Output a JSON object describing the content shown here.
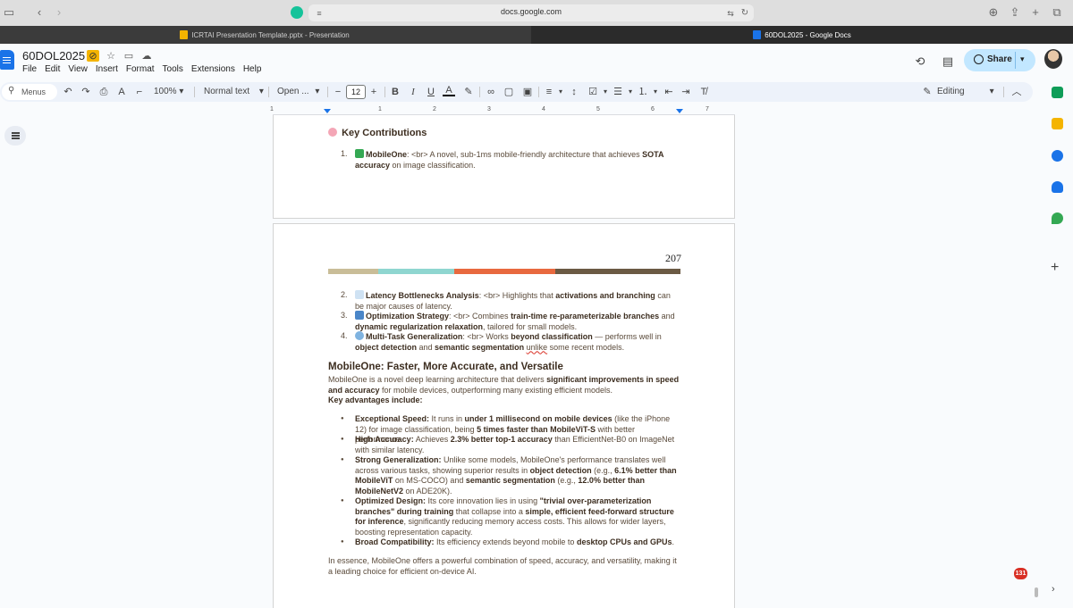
{
  "browser": {
    "url": "docs.google.com",
    "tabs": [
      {
        "title": "ICRTAI Presentation Template.pptx - Presentation",
        "active": false
      },
      {
        "title": "60DOL2025 - Google Docs",
        "active": true
      }
    ]
  },
  "doc": {
    "title": "60DOL2025",
    "menu": [
      "File",
      "Edit",
      "View",
      "Insert",
      "Format",
      "Tools",
      "Extensions",
      "Help"
    ],
    "share_label": "Share"
  },
  "toolbar": {
    "menus_label": "Menus",
    "zoom": "100%",
    "style": "Normal text",
    "font": "Open ...",
    "font_size": "12",
    "mode": "Editing"
  },
  "ruler": {
    "numbers": [
      "1",
      "1",
      "2",
      "3",
      "4",
      "5",
      "6",
      "7"
    ]
  },
  "page1": {
    "heading": "Key Contributions",
    "item1_num": "1.",
    "item1_bold": "MobileOne",
    "item1_a": ": <br> A novel, sub-1ms mobile-friendly architecture that achieves ",
    "item1_bold2": "SOTA accuracy",
    "item1_b": " on image classification."
  },
  "page2": {
    "page_number": "207",
    "items": [
      {
        "num": "2.",
        "bold": "Latency Bottlenecks Analysis",
        "text_a": ": <br> Highlights that ",
        "bold2": "activations and branching",
        "text_b": " can be major causes of latency."
      },
      {
        "num": "3.",
        "bold": "Optimization Strategy",
        "text_a": ": <br> Combines ",
        "bold2": "train-time re-parameterizable branches",
        "text_b": " and ",
        "bold3": "dynamic regularization relaxation",
        "text_c": ", tailored for small models."
      },
      {
        "num": "4.",
        "bold": "Multi-Task Generalization",
        "text_a": ": <br> Works ",
        "bold2": "beyond classification",
        "text_b": " — performs well in ",
        "bold3": "object detection",
        "text_c": " and ",
        "bold4": "semantic segmentation",
        "text_d": " ",
        "err": "unlike",
        "text_e": " some recent models."
      }
    ],
    "heading": "MobileOne: Faster, More Accurate, and Versatile",
    "intro_a": "MobileOne is a novel deep learning architecture that delivers ",
    "intro_bold": "significant improvements in speed and accuracy",
    "intro_b": " for mobile devices, outperforming many existing efficient models.",
    "key_adv": "Key advantages include:",
    "bullets": [
      {
        "label": "Exceptional Speed:",
        "a": " It runs in ",
        "b1": "under 1 millisecond on mobile devices",
        "b": " (like the iPhone 12) for image classification, being ",
        "b2": "5 times faster than MobileViT-S",
        "c": " with better performance."
      },
      {
        "label": "High Accuracy:",
        "a": " Achieves ",
        "b1": "2.3% better top-1 accuracy",
        "b": " than EfficientNet-B0 on ImageNet with similar latency."
      },
      {
        "label": "Strong Generalization:",
        "a": " Unlike some models, MobileOne's performance translates well across various tasks, showing superior results in ",
        "b1": "object detection",
        "b": " (e.g., ",
        "b2": "6.1% better than MobileViT",
        "c": " on MS-COCO) and ",
        "b3": "semantic segmentation",
        "d": " (e.g., ",
        "b4": "12.0% better than MobileNetV2",
        "e": " on ADE20K)."
      },
      {
        "label": "Optimized Design:",
        "a": " Its core innovation lies in using ",
        "b1": "\"trivial over-parameterization branches\" during training",
        "b": " that collapse into a ",
        "b2": "simple, efficient feed-forward structure for inference",
        "c": ", significantly reducing memory access costs. This allows for wider layers, boosting representation capacity."
      },
      {
        "label": "Broad Compatibility:",
        "a": " Its efficiency extends beyond mobile to ",
        "b1": "desktop CPUs and GPUs",
        "b": "."
      }
    ],
    "closing": "In essence, MobileOne offers a powerful combination of speed, accuracy, and versatility, making it a leading choice for efficient on-device AI."
  },
  "notification_count": "131",
  "colors": {
    "bar": [
      "#c9bd98",
      "#8fd6d0",
      "#e8693f",
      "#6b5a44"
    ],
    "share_bg": "#c2e7ff",
    "accent": "#1a73e8"
  }
}
